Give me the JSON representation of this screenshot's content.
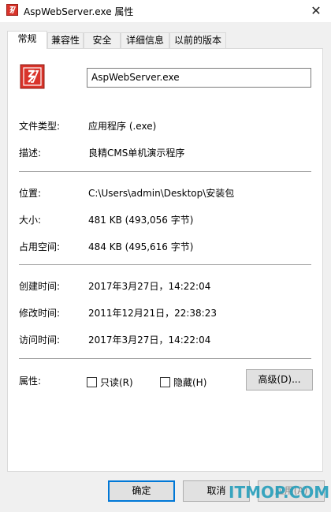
{
  "window": {
    "title": "AspWebServer.exe 属性",
    "close_glyph": "✕"
  },
  "tabs": [
    {
      "label": "常规"
    },
    {
      "label": "兼容性"
    },
    {
      "label": "安全"
    },
    {
      "label": "详细信息"
    },
    {
      "label": "以前的版本"
    }
  ],
  "general": {
    "file_name": "AspWebServer.exe",
    "type_label": "文件类型:",
    "type_value": "应用程序 (.exe)",
    "desc_label": "描述:",
    "desc_value": "良精CMS单机演示程序",
    "location_label": "位置:",
    "location_value": "C:\\Users\\admin\\Desktop\\安装包",
    "size_label": "大小:",
    "size_value": "481 KB (493,056 字节)",
    "disk_label": "占用空间:",
    "disk_value": "484 KB (495,616 字节)",
    "created_label": "创建时间:",
    "created_value": "2017年3月27日，14:22:04",
    "modified_label": "修改时间:",
    "modified_value": "2011年12月21日，22:38:23",
    "accessed_label": "访问时间:",
    "accessed_value": "2017年3月27日，14:22:04",
    "attr_label": "属性:",
    "readonly_label": "只读(R)",
    "hidden_label": "隐藏(H)",
    "advanced_label": "高级(D)..."
  },
  "buttons": {
    "ok": "确定",
    "cancel": "取消",
    "apply": "应用(A)"
  },
  "watermark": "ITMOP.COM",
  "colors": {
    "icon_red": "#d9342b",
    "accent": "#0078d7"
  }
}
